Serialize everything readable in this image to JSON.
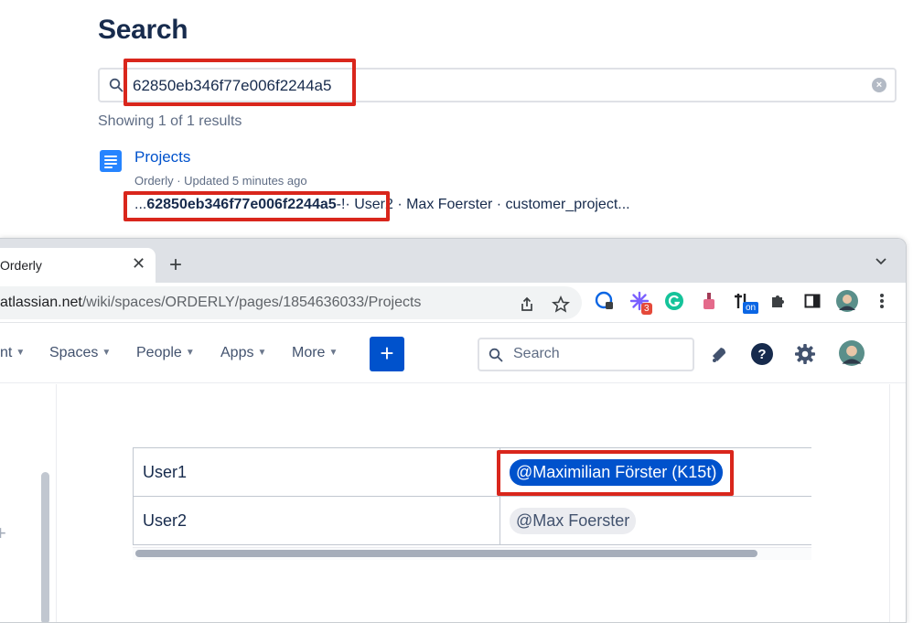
{
  "search_page": {
    "title": "Search",
    "query": "62850eb346f77e006f2244a5",
    "results_count": "Showing 1 of 1 results",
    "result": {
      "title": "Projects",
      "meta": "Orderly · Updated 5 minutes ago",
      "snippet_prefix": "...",
      "snippet_match": "62850eb346f77e006f2244a5",
      "snippet_suffix": "-!· User2 · Max Foerster · customer_project..."
    }
  },
  "browser": {
    "tab_title": "Orderly",
    "tab_close": "✕",
    "new_tab": "+",
    "url_host": "atlassian.net",
    "url_path": "/wiki/spaces/ORDERLY/pages/1854636033/Projects",
    "extension_badges": {
      "count": "3",
      "toggle": "on"
    }
  },
  "app_nav": {
    "items": [
      "nt",
      "Spaces",
      "People",
      "Apps",
      "More"
    ],
    "create_label": "+",
    "search_placeholder": "Search"
  },
  "table": {
    "rows": [
      {
        "label": "User1",
        "mention": "@Maximilian Förster (K15t)"
      },
      {
        "label": "User2",
        "mention": "@Max Foerster"
      }
    ]
  },
  "colors": {
    "highlight_box": "#d9261c",
    "brand_blue": "#0052cc",
    "link_blue": "#0052cc"
  }
}
